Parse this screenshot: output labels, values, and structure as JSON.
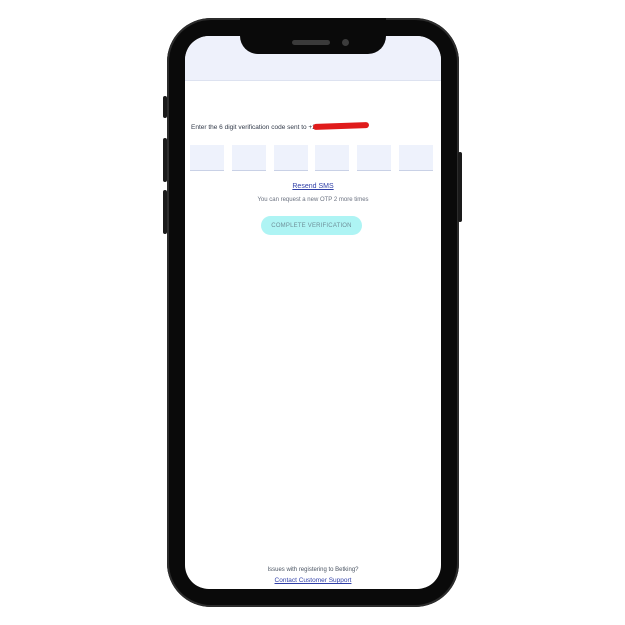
{
  "verification": {
    "instruction": "Enter the 6 digit verification code sent to +23",
    "otp_values": [
      "",
      "",
      "",
      "",
      "",
      ""
    ],
    "resend_label": "Resend SMS",
    "otp_note": "You can request a new OTP 2 more times",
    "complete_label": "COMPLETE VERIFICATION"
  },
  "footer": {
    "question": "Issues with registering to Betking?",
    "support_link": "Contact Customer Support"
  },
  "colors": {
    "phone_frame": "#0a0a0a",
    "header_bg": "#eef1fb",
    "otp_box_bg": "#eef2fc",
    "link": "#2f3fa8",
    "button_bg": "#aef4f4",
    "redaction": "#e01b1b"
  }
}
